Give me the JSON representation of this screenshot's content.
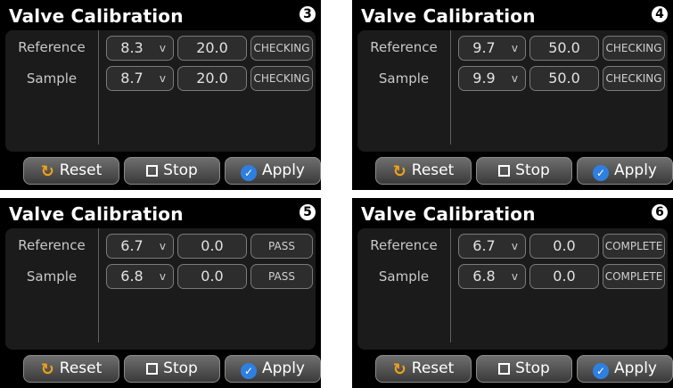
{
  "panels": [
    {
      "title": "Valve Calibration",
      "step": "3",
      "rows": [
        {
          "label": "Reference",
          "select_value": "8.3",
          "unit": "v",
          "value": "20.0",
          "status": "CHECKING"
        },
        {
          "label": "Sample",
          "select_value": "8.7",
          "unit": "v",
          "value": "20.0",
          "status": "CHECKING"
        }
      ],
      "buttons": {
        "reset": "Reset",
        "stop": "Stop",
        "apply": "Apply"
      }
    },
    {
      "title": "Valve Calibration",
      "step": "4",
      "rows": [
        {
          "label": "Reference",
          "select_value": "9.7",
          "unit": "v",
          "value": "50.0",
          "status": "CHECKING"
        },
        {
          "label": "Sample",
          "select_value": "9.9",
          "unit": "v",
          "value": "50.0",
          "status": "CHECKING"
        }
      ],
      "buttons": {
        "reset": "Reset",
        "stop": "Stop",
        "apply": "Apply"
      }
    },
    {
      "title": "Valve Calibration",
      "step": "5",
      "rows": [
        {
          "label": "Reference",
          "select_value": "6.7",
          "unit": "v",
          "value": "0.0",
          "status": "PASS"
        },
        {
          "label": "Sample",
          "select_value": "6.8",
          "unit": "v",
          "value": "0.0",
          "status": "PASS"
        }
      ],
      "buttons": {
        "reset": "Reset",
        "stop": "Stop",
        "apply": "Apply"
      }
    },
    {
      "title": "Valve Calibration",
      "step": "6",
      "rows": [
        {
          "label": "Reference",
          "select_value": "6.7",
          "unit": "v",
          "value": "0.0",
          "status": "COMPLETE"
        },
        {
          "label": "Sample",
          "select_value": "6.8",
          "unit": "v",
          "value": "0.0",
          "status": "COMPLETE"
        }
      ],
      "buttons": {
        "reset": "Reset",
        "stop": "Stop",
        "apply": "Apply"
      }
    }
  ],
  "icons": {
    "reset": "reset-icon",
    "stop": "stop-icon",
    "apply": "check-icon"
  },
  "colors": {
    "reset_icon": "#f0a21a",
    "apply_icon": "#2f7fe0",
    "background": "#000000"
  }
}
